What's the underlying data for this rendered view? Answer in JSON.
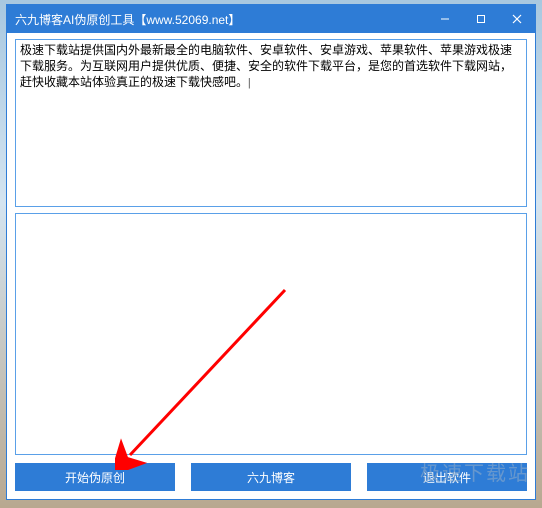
{
  "titlebar": {
    "title": "六九博客AI伪原创工具【www.52069.net】"
  },
  "input": {
    "value": "极速下载站提供国内外最新最全的电脑软件、安卓软件、安卓游戏、苹果软件、苹果游戏极速下载服务。为互联网用户提供优质、便捷、安全的软件下载平台，是您的首选软件下载网站，赶快收藏本站体验真正的极速下载快感吧。|"
  },
  "output": {
    "value": ""
  },
  "buttons": {
    "start": "开始伪原创",
    "blog": "六九博客",
    "exit": "退出软件"
  },
  "watermark": "极速下载站"
}
